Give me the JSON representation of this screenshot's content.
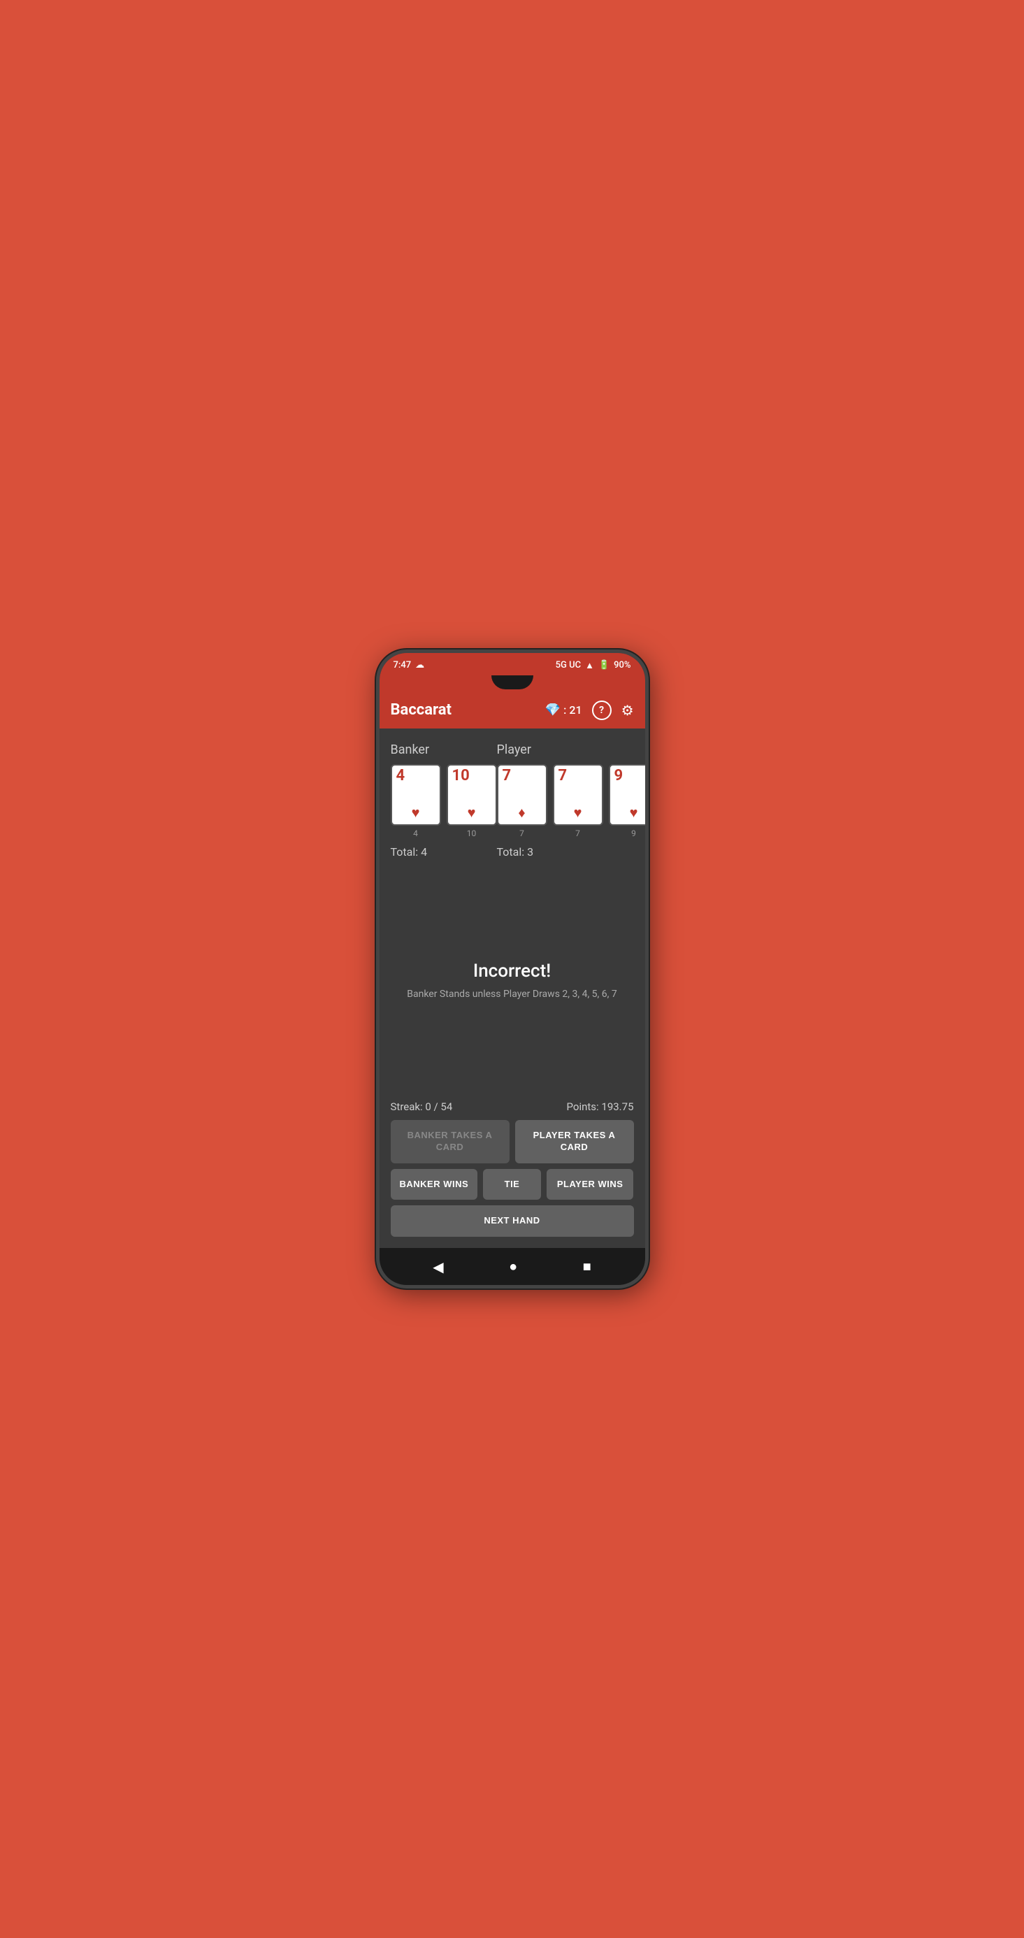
{
  "statusBar": {
    "time": "7:47",
    "cloudIcon": "☁",
    "network": "5G UC",
    "signal": "📶",
    "battery": "90%"
  },
  "appBar": {
    "title": "Baccarat",
    "gemIcon": "💎",
    "gemScore": "21",
    "helpLabel": "?",
    "settingsIcon": "⚙"
  },
  "banker": {
    "label": "Banker",
    "cards": [
      {
        "value": "4",
        "suit": "♥",
        "suitName": "heart",
        "pointValue": "4"
      },
      {
        "value": "10",
        "suit": "♥",
        "suitName": "heart",
        "pointValue": "10"
      }
    ],
    "total": "Total: 4"
  },
  "player": {
    "label": "Player",
    "cards": [
      {
        "value": "7",
        "suit": "♦",
        "suitName": "diamond",
        "pointValue": "7"
      },
      {
        "value": "7",
        "suit": "♥",
        "suitName": "heart",
        "pointValue": "7"
      },
      {
        "value": "9",
        "suit": "♥",
        "suitName": "heart",
        "pointValue": "9"
      }
    ],
    "total": "Total: 3"
  },
  "feedback": {
    "result": "Incorrect!",
    "detail": "Banker Stands unless Player Draws 2, 3, 4, 5, 6, 7"
  },
  "stats": {
    "streak": "Streak: 0 / 54",
    "points": "Points: 193.75"
  },
  "buttons": {
    "bankerTakesCard": "BANKER TAKES A CARD",
    "playerTakesCard": "PLAYER TAKES A CARD",
    "bankerWins": "BANKER WINS",
    "tie": "TIE",
    "playerWins": "PLAYER WINS",
    "nextHand": "NEXT HAND"
  }
}
